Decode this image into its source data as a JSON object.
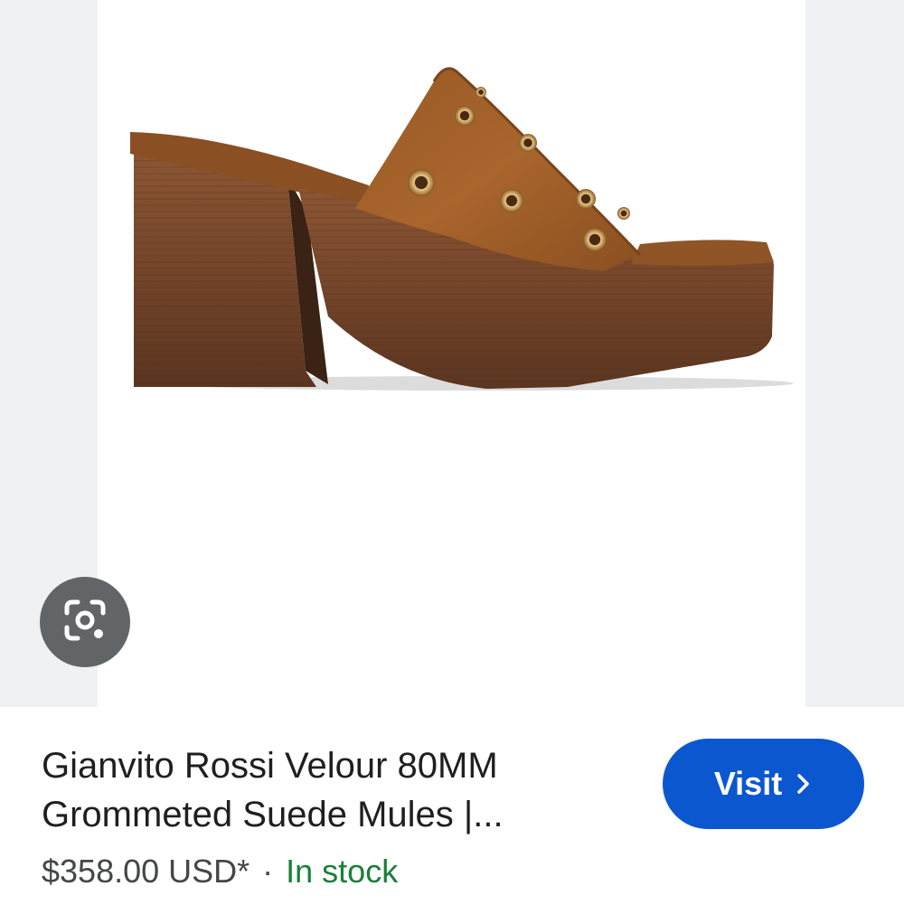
{
  "result": {
    "title": "Gianvito Rossi Velour 80MM Grommeted Suede Mules |...",
    "price": "$358.00 USD*",
    "separator": "·",
    "availability": "In stock",
    "visit_label": "Visit"
  },
  "icons": {
    "lens": "google-lens-icon",
    "visit_arrow": "chevron-right-icon"
  },
  "colors": {
    "visit_button": "#0b57d0",
    "in_stock": "#188038",
    "lens_button": "#626567"
  }
}
